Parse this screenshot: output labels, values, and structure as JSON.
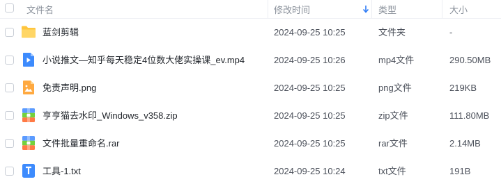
{
  "header": {
    "name_label": "文件名",
    "time_label": "修改时间",
    "type_label": "类型",
    "size_label": "大小",
    "sort_icon": "arrow-down-icon",
    "accent": "#2f7cf6"
  },
  "files": [
    {
      "name": "蓝剑剪辑",
      "time": "2024-09-25 10:25",
      "type": "文件夹",
      "size": "-",
      "icon": "folder-icon"
    },
    {
      "name": "小说推文—知乎每天稳定4位数大佬实操课_ev.mp4",
      "time": "2024-09-25 10:26",
      "type": "mp4文件",
      "size": "290.50MB",
      "icon": "video-file-icon"
    },
    {
      "name": "免责声明.png",
      "time": "2024-09-25 10:25",
      "type": "png文件",
      "size": "219KB",
      "icon": "image-file-icon"
    },
    {
      "name": "亨亨猫去水印_Windows_v358.zip",
      "time": "2024-09-25 10:25",
      "type": "zip文件",
      "size": "111.80MB",
      "icon": "archive-file-icon"
    },
    {
      "name": "文件批量重命名.rar",
      "time": "2024-09-25 10:25",
      "type": "rar文件",
      "size": "2.14MB",
      "icon": "archive-file-icon"
    },
    {
      "name": "工具-1.txt",
      "time": "2024-09-25 10:24",
      "type": "txt文件",
      "size": "191B",
      "icon": "text-file-icon"
    }
  ]
}
